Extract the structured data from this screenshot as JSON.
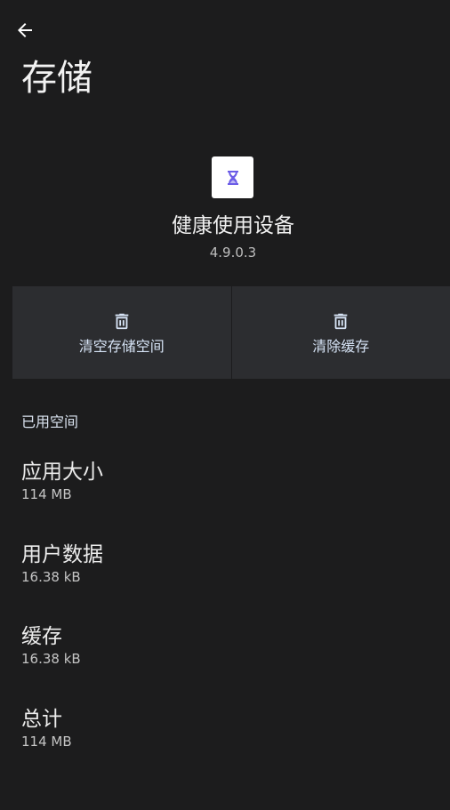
{
  "header": {
    "back_icon": "arrow-left-icon",
    "title": "存储"
  },
  "app": {
    "icon": "hourglass-icon",
    "icon_color": "#6b5ce7",
    "name": "健康使用设备",
    "version": "4.9.0.3"
  },
  "actions": [
    {
      "icon": "trash-icon",
      "label": "清空存储空间"
    },
    {
      "icon": "trash-icon",
      "label": "清除缓存"
    }
  ],
  "section": {
    "header": "已用空间",
    "items": [
      {
        "title": "应用大小",
        "value": "114 MB"
      },
      {
        "title": "用户数据",
        "value": "16.38 kB"
      },
      {
        "title": "缓存",
        "value": "16.38 kB"
      },
      {
        "title": "总计",
        "value": "114 MB"
      }
    ]
  },
  "colors": {
    "background": "#1c1c1d",
    "action_bar": "#2c2d30",
    "accent_text": "#d6e3f5"
  }
}
